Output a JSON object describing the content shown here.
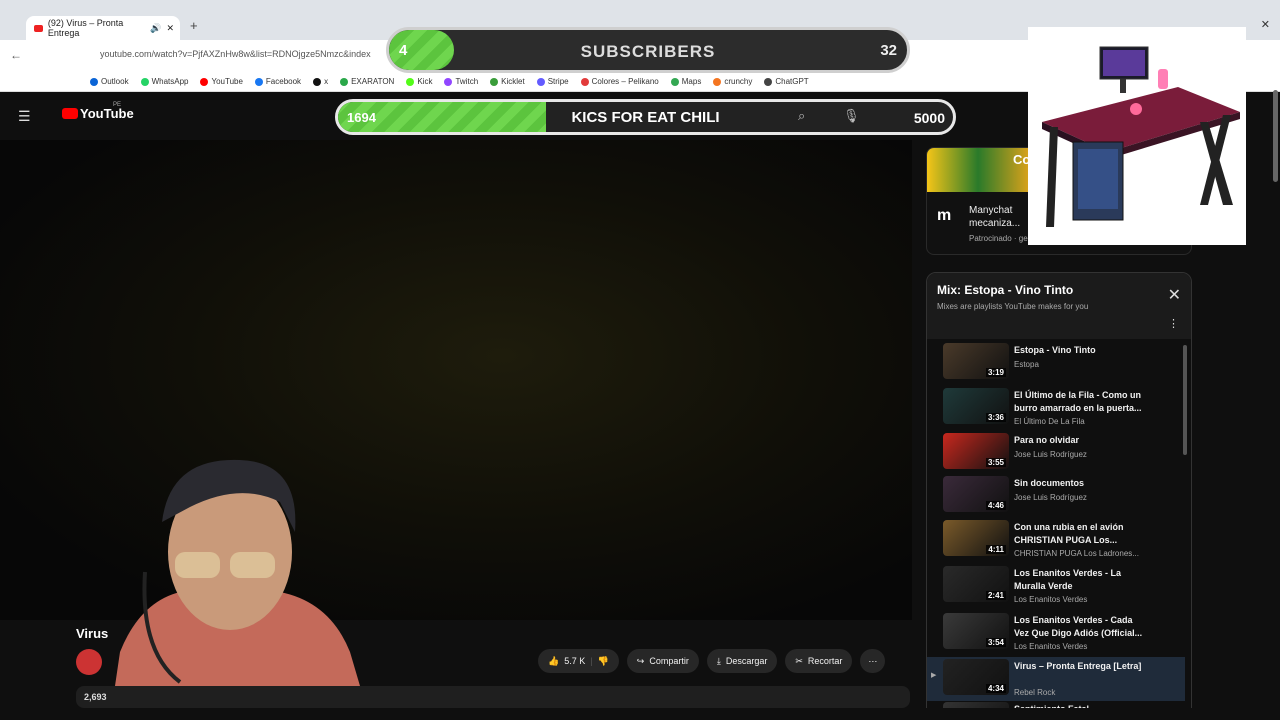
{
  "browser": {
    "tab_title": "(92) Virus – Pronta Entrega",
    "url": "youtube.com/watch?v=PjfAXZnHw8w&list=RDNOjgze5Nmzc&index",
    "bookmarks": [
      {
        "label": "Outlook",
        "color": "#0a64d6"
      },
      {
        "label": "WhatsApp",
        "color": "#25d366"
      },
      {
        "label": "YouTube",
        "color": "#ff0000"
      },
      {
        "label": "Facebook",
        "color": "#1877f2"
      },
      {
        "label": "x",
        "color": "#111111"
      },
      {
        "label": "EXARATON",
        "color": "#2aa84a"
      },
      {
        "label": "Kick",
        "color": "#53fc18"
      },
      {
        "label": "Twitch",
        "color": "#9146ff"
      },
      {
        "label": "Kicklet",
        "color": "#3a9d3a"
      },
      {
        "label": "Stripe",
        "color": "#635bff"
      },
      {
        "label": "Colores – Pelikano",
        "color": "#e23b3b"
      },
      {
        "label": "Maps",
        "color": "#34a853"
      },
      {
        "label": "crunchy",
        "color": "#f47521"
      },
      {
        "label": "ChatGPT",
        "color": "#444444"
      }
    ]
  },
  "youtube": {
    "logo_text": "YouTube",
    "region": "PE"
  },
  "overlay": {
    "subscribers": {
      "label": "SUBSCRIBERS",
      "current": "4",
      "goal": "32",
      "progress": 0.125
    },
    "kicks": {
      "label": "KICS FOR EAT CHILI",
      "current": "1694",
      "goal": "5000",
      "progress": 0.339
    }
  },
  "video": {
    "title": "Virus",
    "likes": "5.7 K",
    "share_label": "Compartir",
    "download_label": "Descargar",
    "clip_label": "Recortar",
    "views": "2,693"
  },
  "ad": {
    "tag": "Co th",
    "brand_logo": "m",
    "text": "Manychat mecaniza...",
    "sponsored": "Patrocinado · ge"
  },
  "playlist": {
    "title": "Mix: Estopa - Vino Tinto",
    "subtitle": "Mixes are playlists YouTube makes for you",
    "items": [
      {
        "title": "Estopa - Vino Tinto",
        "channel": "Estopa",
        "duration": "3:19",
        "color": "#4a3a2a"
      },
      {
        "title": "El Último de la Fila - Como un burro amarrado en la puerta...",
        "channel": "El Último De La Fila",
        "duration": "3:36",
        "color": "#1f3a3a"
      },
      {
        "title": "Para no olvidar",
        "channel": "Jose Luis Rodríguez",
        "duration": "3:55",
        "color": "#c8281e"
      },
      {
        "title": "Sin documentos",
        "channel": "Jose Luis Rodríguez",
        "duration": "4:46",
        "color": "#3a2a3a"
      },
      {
        "title": "Con una rubia en el avión CHRISTIAN PUGA Los...",
        "channel": "CHRISTIAN PUGA Los Ladrones...",
        "duration": "4:11",
        "color": "#7a5a2a"
      },
      {
        "title": "Los Enanitos Verdes - La Muralla Verde",
        "channel": "Los Enanitos Verdes",
        "duration": "2:41",
        "color": "#2a2a2a"
      },
      {
        "title": "Los Enanitos Verdes - Cada Vez Que Digo Adiós (Official...",
        "channel": "Los Enanitos Verdes",
        "duration": "3:54",
        "color": "#3a3a3a"
      },
      {
        "title": "Virus – Pronta Entrega [Letra]",
        "channel": "Rebel Rock",
        "duration": "4:34",
        "color": "#222222",
        "active": true
      },
      {
        "title": "Sentimiento Fatal",
        "channel": "",
        "duration": "",
        "color": "#333333"
      }
    ]
  }
}
